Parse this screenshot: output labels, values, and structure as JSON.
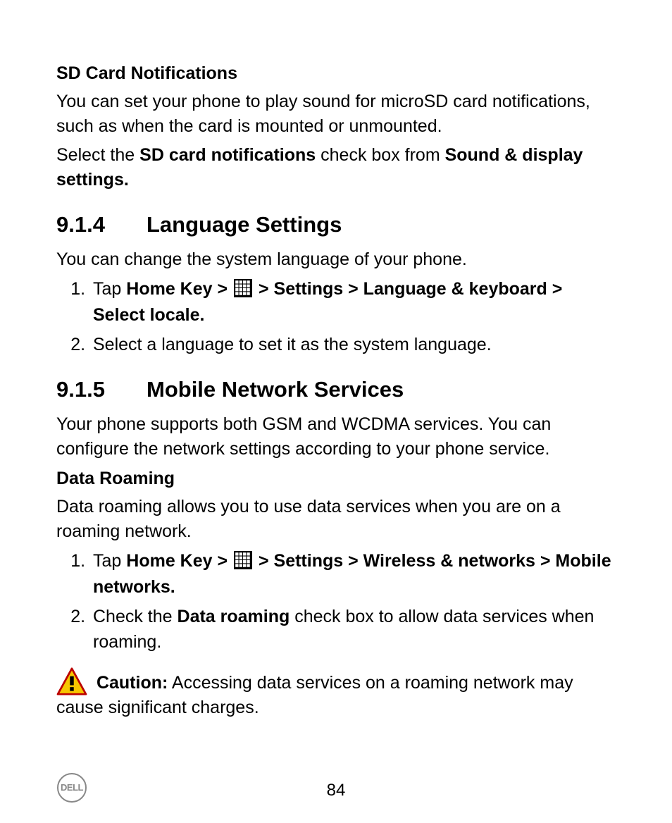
{
  "page_number": "84",
  "icons": {
    "apps": "apps-grid-icon",
    "caution": "caution-triangle-icon",
    "logo": "dell-logo"
  },
  "sd": {
    "heading": "SD Card Notifications",
    "p1": "You can set your phone to play sound for microSD card notifications, such as when the card is mounted or unmounted.",
    "p2_pre": "Select the ",
    "p2_b1": "SD card notifications",
    "p2_mid": " check box from ",
    "p2_b2": "Sound & display settings."
  },
  "lang": {
    "section_no": "9.1.4",
    "section_title": "Language Settings",
    "intro": "You can change the system language of your phone.",
    "step1_pre": "Tap ",
    "step1_b1": "Home Key > ",
    "step1_b2": " > Settings > Language & keyboard > Select locale.",
    "step2": "Select a language to set it as the system language."
  },
  "net": {
    "section_no": "9.1.5",
    "section_title": "Mobile Network Services",
    "intro": "Your phone supports both GSM and WCDMA services. You can configure the network settings according to your phone service.",
    "dr_heading": "Data Roaming",
    "dr_intro": "Data roaming allows you to use data services when you are on a roaming network.",
    "step1_pre": "Tap ",
    "step1_b1": "Home Key > ",
    "step1_b2": " > Settings > Wireless & networks > Mobile networks.",
    "step2_pre": "Check the ",
    "step2_b1": "Data roaming",
    "step2_post": " check box to allow data services when roaming.",
    "caution_label": "Caution:",
    "caution_text": " Accessing data services on a roaming network may cause significant charges."
  }
}
